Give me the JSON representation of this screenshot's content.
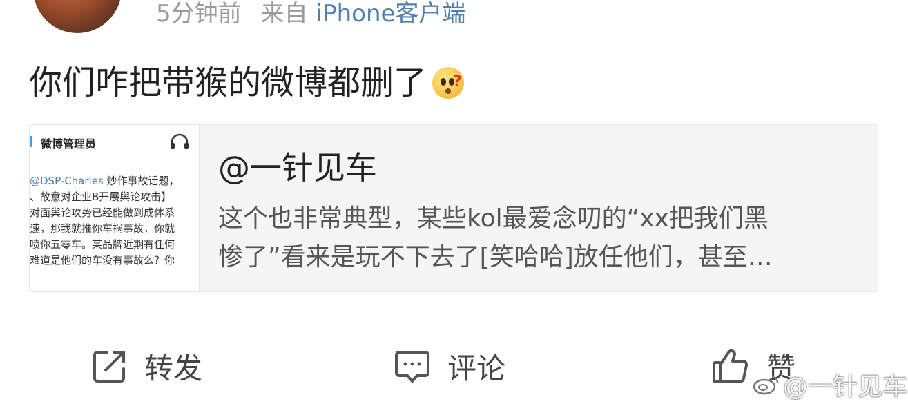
{
  "post": {
    "time": "5分钟前",
    "from_label": "来自",
    "client": "iPhone客户端",
    "text": "你们咋把带猴的微博都删了",
    "emoji": "confused-face-icon"
  },
  "quote_card": {
    "thumbnail": {
      "title": "微博管理员",
      "listen_icon": "headphones-icon",
      "mention": "@DSP-Charles",
      "line1_rest": " 炒作事故话题，",
      "line2": "、故意对企业B开展舆论攻击】",
      "line3": "对面舆论攻势已经能做到成体系",
      "line4": "速，那我就推你车祸事故，你就",
      "line5": "喷你五零车。某品牌近期有任何",
      "line6": "难道是他们的车没有事故么？你"
    },
    "author": "@一针见车",
    "text_line1": "这个也非常典型，某些kol最爱念叨的“xx把我们黑",
    "text_line2": "惨了”看来是玩不下去了[笑哈哈]放任他们，甚至…"
  },
  "actions": {
    "repost": "转发",
    "comment": "评论",
    "like": "赞"
  },
  "watermark": "@一针见车",
  "colors": {
    "meta_gray": "#9a9a9a",
    "link_blue": "#4f7fb0",
    "card_bg": "#f5f5f5",
    "text_dark": "#222222"
  }
}
